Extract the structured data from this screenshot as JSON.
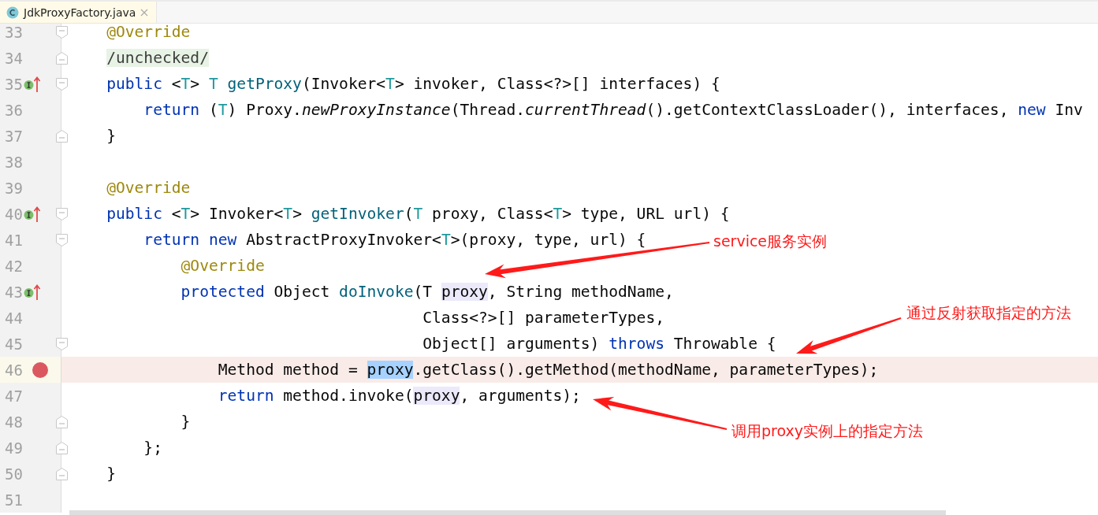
{
  "tab": {
    "title": "JdkProxyFactory.java",
    "selected": true
  },
  "lines": [
    {
      "number": "33",
      "fold_start": true,
      "fold_end": false,
      "implements_marker": false,
      "breakpoint": false,
      "current": false,
      "tokens": [
        {
          "text": "    @Override",
          "kind": "ann"
        }
      ]
    },
    {
      "number": "34",
      "fold_start": false,
      "fold_end": true,
      "implements_marker": false,
      "breakpoint": false,
      "current": false,
      "tokens": [
        {
          "text": "    /unchecked/",
          "kind": "folded"
        }
      ]
    },
    {
      "number": "35",
      "fold_start": true,
      "fold_end": false,
      "implements_marker": true,
      "breakpoint": false,
      "current": false,
      "tokens": [
        {
          "text": "    public",
          "kind": "kw"
        },
        {
          "text": " <"
        },
        {
          "text": "T",
          "kind": "tp"
        },
        {
          "text": "> "
        },
        {
          "text": "T",
          "kind": "tp"
        },
        {
          "text": " getProxy",
          "kind": "fn"
        },
        {
          "text": "(Invoker<"
        },
        {
          "text": "T",
          "kind": "tp"
        },
        {
          "text": "> invoker, Class<?>[] interfaces) {"
        }
      ]
    },
    {
      "number": "36",
      "fold_start": false,
      "fold_end": false,
      "implements_marker": false,
      "breakpoint": false,
      "current": false,
      "tokens": [
        {
          "text": "        return",
          "kind": "kw"
        },
        {
          "text": " ("
        },
        {
          "text": "T",
          "kind": "tp"
        },
        {
          "text": ") Proxy."
        },
        {
          "text": "newProxyInstance",
          "kind": "italic"
        },
        {
          "text": "(Thread."
        },
        {
          "text": "currentThread",
          "kind": "italic"
        },
        {
          "text": "().getContextClassLoader(), interfaces, "
        },
        {
          "text": "new",
          "kind": "kw"
        },
        {
          "text": " Inv"
        }
      ]
    },
    {
      "number": "37",
      "fold_start": false,
      "fold_end": true,
      "implements_marker": false,
      "breakpoint": false,
      "current": false,
      "tokens": [
        {
          "text": "    }"
        }
      ]
    },
    {
      "number": "38",
      "fold_start": false,
      "fold_end": false,
      "implements_marker": false,
      "breakpoint": false,
      "current": false
    },
    {
      "number": "39",
      "fold_start": false,
      "fold_end": false,
      "implements_marker": false,
      "breakpoint": false,
      "current": false,
      "tokens": [
        {
          "text": "    @Override",
          "kind": "ann"
        }
      ]
    },
    {
      "number": "40",
      "fold_start": true,
      "fold_end": false,
      "implements_marker": true,
      "breakpoint": false,
      "current": false,
      "tokens": [
        {
          "text": "    public",
          "kind": "kw"
        },
        {
          "text": " <"
        },
        {
          "text": "T",
          "kind": "tp"
        },
        {
          "text": "> Invoker<"
        },
        {
          "text": "T",
          "kind": "tp"
        },
        {
          "text": "> "
        },
        {
          "text": "getInvoker",
          "kind": "fn"
        },
        {
          "text": "("
        },
        {
          "text": "T",
          "kind": "tp"
        },
        {
          "text": " proxy, Class<"
        },
        {
          "text": "T",
          "kind": "tp"
        },
        {
          "text": "> type, URL url) {"
        }
      ]
    },
    {
      "number": "41",
      "fold_start": true,
      "fold_end": false,
      "implements_marker": false,
      "breakpoint": false,
      "current": false,
      "tokens": [
        {
          "text": "        return new",
          "kind": "kw"
        },
        {
          "text": " AbstractProxyInvoker<"
        },
        {
          "text": "T",
          "kind": "tp"
        },
        {
          "text": ">(proxy, type, url) {"
        }
      ]
    },
    {
      "number": "42",
      "fold_start": false,
      "fold_end": false,
      "implements_marker": false,
      "breakpoint": false,
      "current": false,
      "tokens": [
        {
          "text": "            @Override",
          "kind": "ann"
        }
      ]
    },
    {
      "number": "43",
      "fold_start": false,
      "fold_end": false,
      "implements_marker": true,
      "breakpoint": false,
      "current": false,
      "tokens": [
        {
          "text": "            protected",
          "kind": "kw"
        },
        {
          "text": " Object "
        },
        {
          "text": "doInvoke",
          "kind": "fn"
        },
        {
          "text": "(T "
        },
        {
          "text": "proxy",
          "kind": "usage"
        },
        {
          "text": ", String methodName,"
        }
      ]
    },
    {
      "number": "44",
      "fold_start": false,
      "fold_end": false,
      "implements_marker": false,
      "breakpoint": false,
      "current": false,
      "tokens": [
        {
          "text": "                                      Class<?>[] parameterTypes,"
        }
      ]
    },
    {
      "number": "45",
      "fold_start": true,
      "fold_end": false,
      "implements_marker": false,
      "breakpoint": false,
      "current": false,
      "tokens": [
        {
          "text": "                                      Object[] arguments) "
        },
        {
          "text": "throws",
          "kind": "kw"
        },
        {
          "text": " Throwable {"
        }
      ]
    },
    {
      "number": "46",
      "fold_start": false,
      "fold_end": false,
      "implements_marker": false,
      "breakpoint": true,
      "current": true,
      "tokens": [
        {
          "text": "                Method method = "
        },
        {
          "text": "proxy",
          "kind": "selection"
        },
        {
          "text": ".getClass().getMethod(methodName, parameterTypes);"
        }
      ]
    },
    {
      "number": "47",
      "fold_start": false,
      "fold_end": false,
      "implements_marker": false,
      "breakpoint": false,
      "current": false,
      "tokens": [
        {
          "text": "                return",
          "kind": "kw"
        },
        {
          "text": " method.invoke("
        },
        {
          "text": "proxy",
          "kind": "usage"
        },
        {
          "text": ", arguments);"
        }
      ]
    },
    {
      "number": "48",
      "fold_start": false,
      "fold_end": true,
      "implements_marker": false,
      "breakpoint": false,
      "current": false,
      "tokens": [
        {
          "text": "            }"
        }
      ]
    },
    {
      "number": "49",
      "fold_start": false,
      "fold_end": true,
      "implements_marker": false,
      "breakpoint": false,
      "current": false,
      "tokens": [
        {
          "text": "        };"
        }
      ]
    },
    {
      "number": "50",
      "fold_start": false,
      "fold_end": true,
      "implements_marker": false,
      "breakpoint": false,
      "current": false,
      "tokens": [
        {
          "text": "    }"
        }
      ]
    },
    {
      "number": "51",
      "fold_start": false,
      "fold_end": false,
      "implements_marker": false,
      "breakpoint": false,
      "current": false
    }
  ],
  "annotations": [
    {
      "text": "service服务实例"
    },
    {
      "text": "通过反射获取指定的方法"
    },
    {
      "text": "调用proxy实例上的指定方法"
    }
  ]
}
